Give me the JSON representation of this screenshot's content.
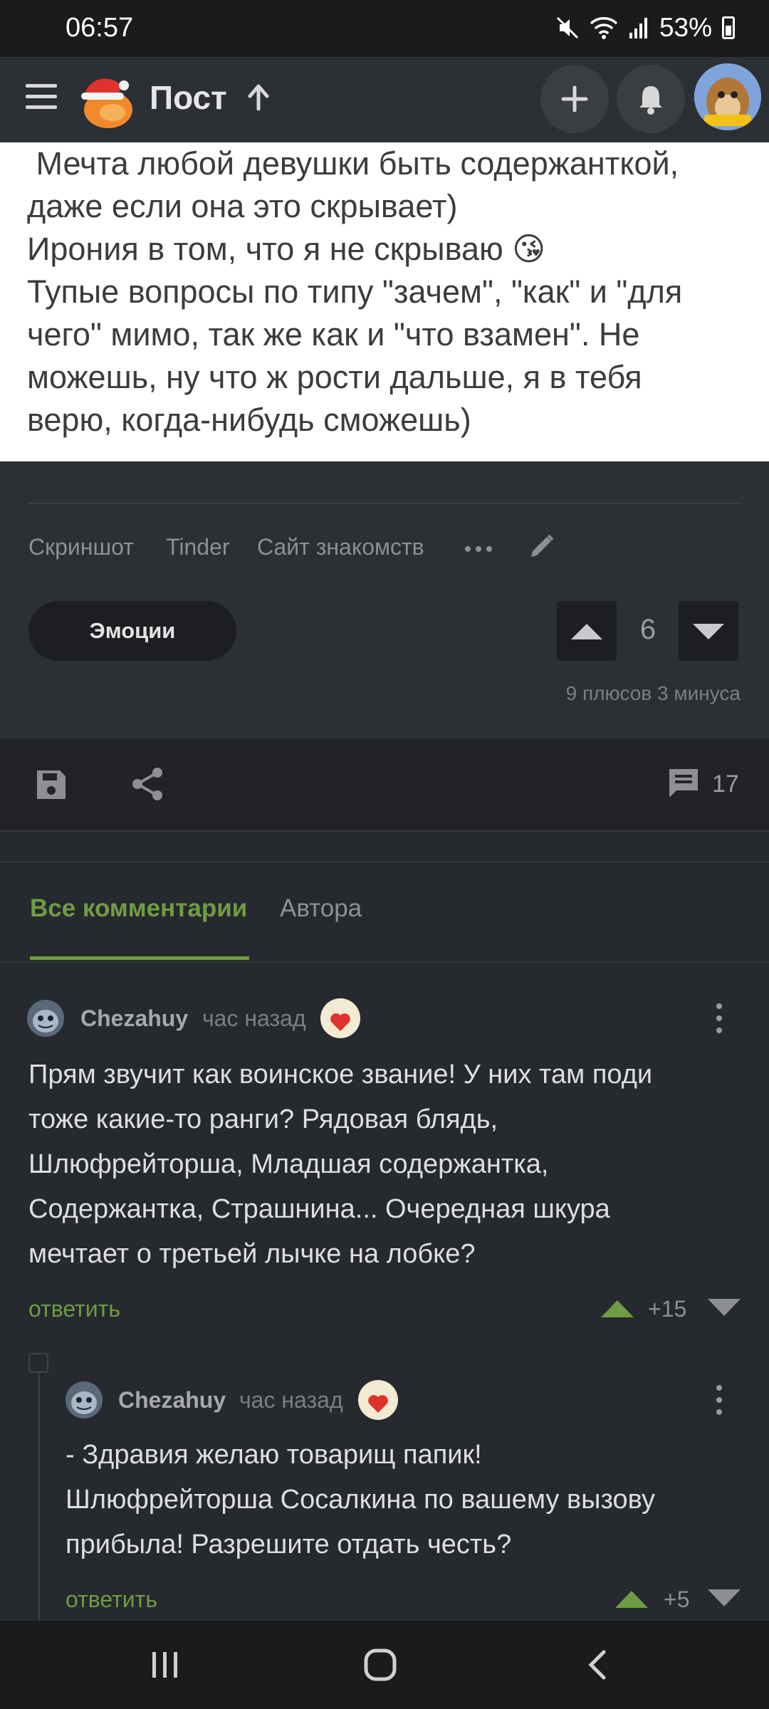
{
  "status_bar": {
    "time": "06:57",
    "battery": "53%"
  },
  "header": {
    "title": "Пост"
  },
  "post": {
    "image_text": " Мечта любой девушки быть содержанткой,\nдаже если она это скрывает)\nИрония в том, что я не скрываю 😘\nТупые вопросы по типу \"зачем\", \"как\" и \"для\nчего\" мимо, так же как и \"что взамен\". Не\nможешь, ну что ж рости дальше, я в тебя\nверю, когда-нибудь сможешь)",
    "tags": [
      "Скриншот",
      "Tinder",
      "Сайт знакомств"
    ],
    "emotions_label": "Эмоции",
    "rating": "6",
    "rating_detail": "9 плюсов 3 минуса",
    "comments_count": "17"
  },
  "tabs": {
    "all": "Все комментарии",
    "author": "Автора"
  },
  "comments": [
    {
      "author": "Chezahuy",
      "time": "час назад",
      "text": "Прям звучит как воинское звание! У них там поди\nтоже какие-то ранги? Рядовая блядь,\nШлюфрейторша, Младшая содержантка,\nСодержантка, Страшнина... Очередная шкура\nмечтает о третьей лычке на лобке?",
      "reply_label": "ответить",
      "score": "+15"
    },
    {
      "author": "Chezahuy",
      "time": "час назад",
      "text": "- Здравия желаю товарищ папик!\nШлюфрейторша Сосалкина по вашему вызову\nприбыла! Разрешите отдать честь?",
      "reply_label": "ответить",
      "score": "+5"
    }
  ],
  "colors": {
    "accent_green": "#6f9c43",
    "background": "#26292e",
    "panel": "#2c2f33"
  },
  "icons": [
    "menu-icon",
    "logo-icon",
    "up-arrow-icon",
    "plus-icon",
    "bell-icon",
    "more-icon",
    "edit-icon",
    "save-icon",
    "share-icon",
    "comment-icon",
    "upvote-icon",
    "downvote-icon",
    "recent-apps-icon",
    "home-icon",
    "back-icon"
  ]
}
